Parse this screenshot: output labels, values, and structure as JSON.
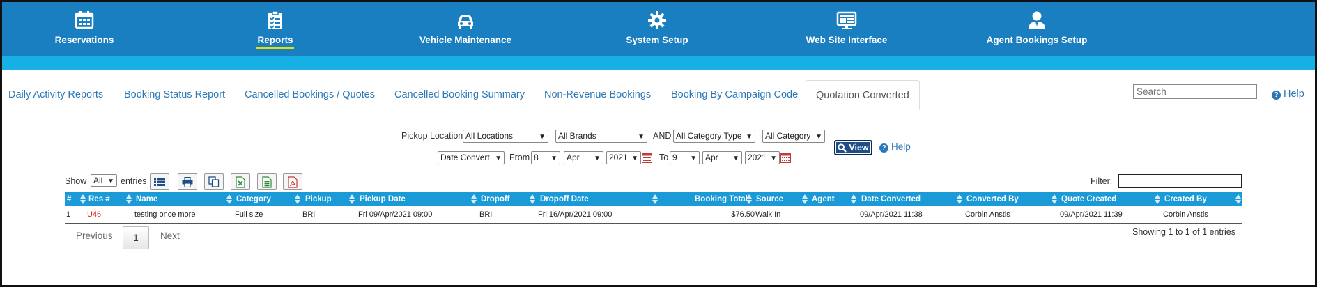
{
  "nav": [
    {
      "label": "Reservations",
      "icon": "calendar-icon"
    },
    {
      "label": "Reports",
      "icon": "clipboard-list-icon",
      "active": true
    },
    {
      "label": "Vehicle Maintenance",
      "icon": "car-icon"
    },
    {
      "label": "System Setup",
      "icon": "gear-icon"
    },
    {
      "label": "Web Site Interface",
      "icon": "monitor-icon"
    },
    {
      "label": "Agent Bookings Setup",
      "icon": "agent-icon"
    }
  ],
  "tabs": [
    {
      "label": "Daily Activity Reports"
    },
    {
      "label": "Booking Status Report"
    },
    {
      "label": "Cancelled Bookings / Quotes"
    },
    {
      "label": "Cancelled Booking Summary"
    },
    {
      "label": "Non-Revenue Bookings"
    },
    {
      "label": "Booking By Campaign Code"
    },
    {
      "label": "Quotation Converted",
      "active": true
    }
  ],
  "search": {
    "placeholder": "Search"
  },
  "help_label": "Help",
  "filters": {
    "pickup_location_label": "Pickup Location",
    "location": "All Locations",
    "brands": "All Brands",
    "and_label": "AND",
    "category_type": "All Category Type",
    "category": "All Category",
    "date_mode": "Date Convert",
    "from_label": "From",
    "from_day": "8",
    "from_month": "Apr",
    "from_year": "2021",
    "to_label": "To",
    "to_day": "9",
    "to_month": "Apr",
    "to_year": "2021",
    "view_label": "View",
    "help_label": "Help"
  },
  "table_controls": {
    "show_label": "Show",
    "show_value": "All",
    "entries_label": "entries",
    "filter_label": "Filter:"
  },
  "table": {
    "columns": [
      "#",
      "Res #",
      "Name",
      "Category",
      "Pickup",
      "Pickup Date",
      "Dropoff",
      "Dropoff Date",
      "Booking Total",
      "Source",
      "Agent",
      "Date Converted",
      "Converted By",
      "Quote Created",
      "Created By"
    ],
    "rows": [
      [
        "1",
        "U46",
        "testing once more",
        "Full size",
        "BRI",
        "Fri 09/Apr/2021 09:00",
        "BRI",
        "Fri 16/Apr/2021 09:00",
        "$76.50",
        "Walk In",
        "",
        "09/Apr/2021 11:38",
        "Corbin Anstis",
        "09/Apr/2021 11:39",
        "Corbin Anstis"
      ]
    ]
  },
  "showing_text": "Showing 1 to 1 of 1 entries",
  "pagination": {
    "previous": "Previous",
    "page": "1",
    "next": "Next"
  },
  "colors": {
    "nav_bg": "#1a7fc1",
    "subbar": "#17b0e4",
    "header_bg": "#1a9bd7",
    "link": "#2a77b8",
    "res_link": "#d9261c"
  }
}
